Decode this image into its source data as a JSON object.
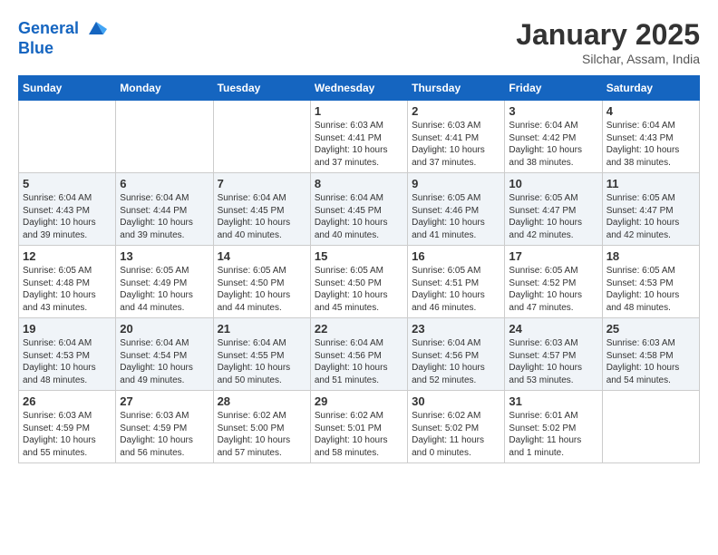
{
  "header": {
    "logo_line1": "General",
    "logo_line2": "Blue",
    "month": "January 2025",
    "location": "Silchar, Assam, India"
  },
  "days_of_week": [
    "Sunday",
    "Monday",
    "Tuesday",
    "Wednesday",
    "Thursday",
    "Friday",
    "Saturday"
  ],
  "weeks": [
    [
      {
        "day": "",
        "info": ""
      },
      {
        "day": "",
        "info": ""
      },
      {
        "day": "",
        "info": ""
      },
      {
        "day": "1",
        "info": "Sunrise: 6:03 AM\nSunset: 4:41 PM\nDaylight: 10 hours and 37 minutes."
      },
      {
        "day": "2",
        "info": "Sunrise: 6:03 AM\nSunset: 4:41 PM\nDaylight: 10 hours and 37 minutes."
      },
      {
        "day": "3",
        "info": "Sunrise: 6:04 AM\nSunset: 4:42 PM\nDaylight: 10 hours and 38 minutes."
      },
      {
        "day": "4",
        "info": "Sunrise: 6:04 AM\nSunset: 4:43 PM\nDaylight: 10 hours and 38 minutes."
      }
    ],
    [
      {
        "day": "5",
        "info": "Sunrise: 6:04 AM\nSunset: 4:43 PM\nDaylight: 10 hours and 39 minutes."
      },
      {
        "day": "6",
        "info": "Sunrise: 6:04 AM\nSunset: 4:44 PM\nDaylight: 10 hours and 39 minutes."
      },
      {
        "day": "7",
        "info": "Sunrise: 6:04 AM\nSunset: 4:45 PM\nDaylight: 10 hours and 40 minutes."
      },
      {
        "day": "8",
        "info": "Sunrise: 6:04 AM\nSunset: 4:45 PM\nDaylight: 10 hours and 40 minutes."
      },
      {
        "day": "9",
        "info": "Sunrise: 6:05 AM\nSunset: 4:46 PM\nDaylight: 10 hours and 41 minutes."
      },
      {
        "day": "10",
        "info": "Sunrise: 6:05 AM\nSunset: 4:47 PM\nDaylight: 10 hours and 42 minutes."
      },
      {
        "day": "11",
        "info": "Sunrise: 6:05 AM\nSunset: 4:47 PM\nDaylight: 10 hours and 42 minutes."
      }
    ],
    [
      {
        "day": "12",
        "info": "Sunrise: 6:05 AM\nSunset: 4:48 PM\nDaylight: 10 hours and 43 minutes."
      },
      {
        "day": "13",
        "info": "Sunrise: 6:05 AM\nSunset: 4:49 PM\nDaylight: 10 hours and 44 minutes."
      },
      {
        "day": "14",
        "info": "Sunrise: 6:05 AM\nSunset: 4:50 PM\nDaylight: 10 hours and 44 minutes."
      },
      {
        "day": "15",
        "info": "Sunrise: 6:05 AM\nSunset: 4:50 PM\nDaylight: 10 hours and 45 minutes."
      },
      {
        "day": "16",
        "info": "Sunrise: 6:05 AM\nSunset: 4:51 PM\nDaylight: 10 hours and 46 minutes."
      },
      {
        "day": "17",
        "info": "Sunrise: 6:05 AM\nSunset: 4:52 PM\nDaylight: 10 hours and 47 minutes."
      },
      {
        "day": "18",
        "info": "Sunrise: 6:05 AM\nSunset: 4:53 PM\nDaylight: 10 hours and 48 minutes."
      }
    ],
    [
      {
        "day": "19",
        "info": "Sunrise: 6:04 AM\nSunset: 4:53 PM\nDaylight: 10 hours and 48 minutes."
      },
      {
        "day": "20",
        "info": "Sunrise: 6:04 AM\nSunset: 4:54 PM\nDaylight: 10 hours and 49 minutes."
      },
      {
        "day": "21",
        "info": "Sunrise: 6:04 AM\nSunset: 4:55 PM\nDaylight: 10 hours and 50 minutes."
      },
      {
        "day": "22",
        "info": "Sunrise: 6:04 AM\nSunset: 4:56 PM\nDaylight: 10 hours and 51 minutes."
      },
      {
        "day": "23",
        "info": "Sunrise: 6:04 AM\nSunset: 4:56 PM\nDaylight: 10 hours and 52 minutes."
      },
      {
        "day": "24",
        "info": "Sunrise: 6:03 AM\nSunset: 4:57 PM\nDaylight: 10 hours and 53 minutes."
      },
      {
        "day": "25",
        "info": "Sunrise: 6:03 AM\nSunset: 4:58 PM\nDaylight: 10 hours and 54 minutes."
      }
    ],
    [
      {
        "day": "26",
        "info": "Sunrise: 6:03 AM\nSunset: 4:59 PM\nDaylight: 10 hours and 55 minutes."
      },
      {
        "day": "27",
        "info": "Sunrise: 6:03 AM\nSunset: 4:59 PM\nDaylight: 10 hours and 56 minutes."
      },
      {
        "day": "28",
        "info": "Sunrise: 6:02 AM\nSunset: 5:00 PM\nDaylight: 10 hours and 57 minutes."
      },
      {
        "day": "29",
        "info": "Sunrise: 6:02 AM\nSunset: 5:01 PM\nDaylight: 10 hours and 58 minutes."
      },
      {
        "day": "30",
        "info": "Sunrise: 6:02 AM\nSunset: 5:02 PM\nDaylight: 11 hours and 0 minutes."
      },
      {
        "day": "31",
        "info": "Sunrise: 6:01 AM\nSunset: 5:02 PM\nDaylight: 11 hours and 1 minute."
      },
      {
        "day": "",
        "info": ""
      }
    ]
  ]
}
